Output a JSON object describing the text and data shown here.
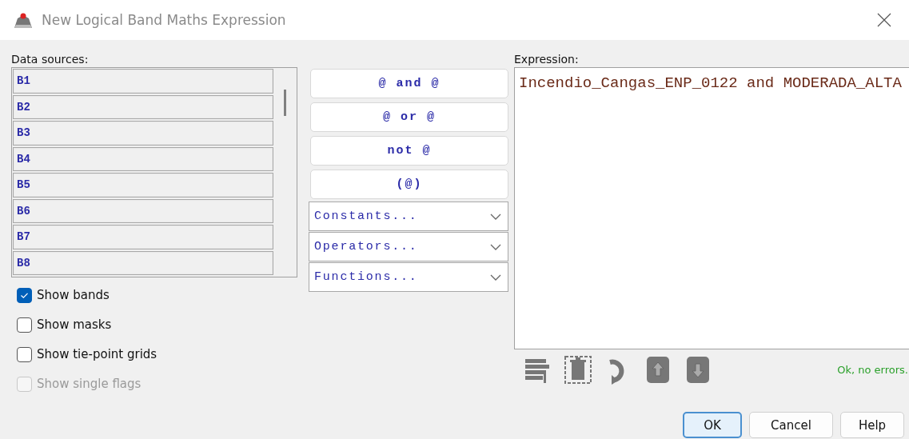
{
  "window": {
    "title": "New Logical Band Maths Expression"
  },
  "data_sources": {
    "label": "Data sources:",
    "items": [
      "B1",
      "B2",
      "B3",
      "B4",
      "B5",
      "B6",
      "B7",
      "B8"
    ]
  },
  "options": [
    {
      "label": "Show bands",
      "checked": true,
      "disabled": false
    },
    {
      "label": "Show masks",
      "checked": false,
      "disabled": false
    },
    {
      "label": "Show tie-point grids",
      "checked": false,
      "disabled": false
    },
    {
      "label": "Show single flags",
      "checked": false,
      "disabled": true
    }
  ],
  "operator_buttons": [
    "@ and @",
    "@ or @",
    "not @",
    "(@)"
  ],
  "dropdowns": [
    "Constants...",
    "Operators...",
    "Functions..."
  ],
  "expression": {
    "label": "Expression:",
    "value": "Incendio_Cangas_ENP_0122 and MODERADA_ALTA"
  },
  "status": "Ok, no errors.",
  "buttons": [
    {
      "label": "OK",
      "selected": true
    },
    {
      "label": "Cancel",
      "selected": false
    },
    {
      "label": "Help",
      "selected": false
    }
  ]
}
